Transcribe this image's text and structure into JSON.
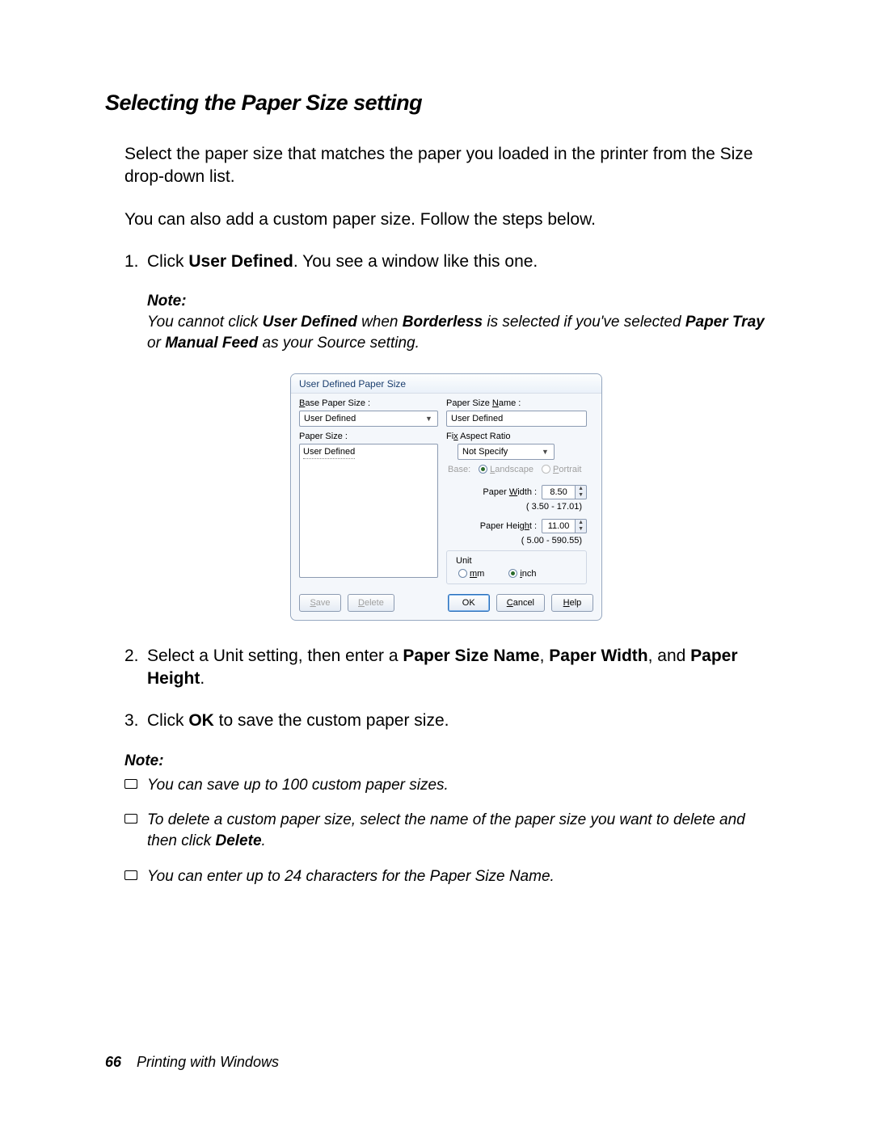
{
  "heading": "Selecting the Paper Size setting",
  "intro1": "Select the paper size that matches the paper you loaded in the printer from the Size drop-down list.",
  "intro2": "You can also add a custom paper size. Follow the steps below.",
  "steps": {
    "s1_prefix": "Click ",
    "s1_bold": "User Defined",
    "s1_suffix": ". You see a window like this one.",
    "s2_prefix": "Select a Unit setting, then enter a ",
    "s2_b1": "Paper Size Name",
    "s2_mid1": ", ",
    "s2_b2": "Paper Width",
    "s2_mid2": ", and ",
    "s2_b3": "Paper Height",
    "s2_suffix": ".",
    "s3_prefix": "Click ",
    "s3_bold": "OK",
    "s3_suffix": " to save the custom paper size."
  },
  "note_label": "Note:",
  "note1_a": "You cannot click ",
  "note1_b1": "User Defined",
  "note1_mid1": " when ",
  "note1_b2": "Borderless",
  "note1_mid2": " is selected if you've selected ",
  "note1_b3": "Paper Tray",
  "note1_mid3": " or ",
  "note1_b4": "Manual Feed",
  "note1_suffix": " as your Source setting.",
  "notes2": {
    "li1": "You can save up to 100 custom paper sizes.",
    "li2_a": "To delete a custom paper size, select the name of the paper size you want to delete and then click ",
    "li2_b": "Delete",
    "li2_c": ".",
    "li3": "You can enter up to 24 characters for the Paper Size Name."
  },
  "dialog": {
    "title": "User Defined Paper Size",
    "base_label_pre": "B",
    "base_label_post": "ase Paper Size :",
    "base_value": "User Defined",
    "paper_size_label": "Paper Size :",
    "list_item": "User Defined",
    "name_label_pre": "Paper Size ",
    "name_label_u": "N",
    "name_label_post": "ame :",
    "name_value": "User Defined",
    "fix_label_pre": "Fi",
    "fix_label_u": "x",
    "fix_label_post": " Aspect Ratio",
    "fix_value": "Not Specify",
    "base_radio": "Base:",
    "landscape_u": "L",
    "landscape_post": "andscape",
    "portrait_u": "P",
    "portrait_post": "ortrait",
    "width_label_pre": "Paper ",
    "width_label_u": "W",
    "width_label_post": "idth :",
    "width_value": "8.50",
    "width_range": "( 3.50 - 17.01)",
    "height_label_pre": "Paper Heig",
    "height_label_u": "h",
    "height_label_post": "t :",
    "height_value": "11.00",
    "height_range": "( 5.00 - 590.55)",
    "unit_title": "Unit",
    "mm_u": "m",
    "mm_post": "m",
    "inch_u": "i",
    "inch_post": "nch",
    "btn_save_u": "S",
    "btn_save_post": "ave",
    "btn_delete_u": "D",
    "btn_delete_post": "elete",
    "btn_ok": "OK",
    "btn_cancel_u": "C",
    "btn_cancel_post": "ancel",
    "btn_help_u": "H",
    "btn_help_post": "elp"
  },
  "footer": {
    "page": "66",
    "section": "Printing with Windows"
  }
}
